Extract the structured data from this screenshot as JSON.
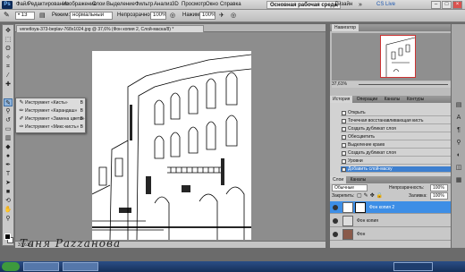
{
  "app": {
    "logo": "Ps",
    "menu": [
      "Файл",
      "Редактирование",
      "Изображение",
      "Слои",
      "Выделение",
      "Фильтр",
      "Анализ",
      "3D",
      "Просмотр",
      "Окно",
      "Справка"
    ],
    "zoom": "37,6",
    "workspace_label": "Основная рабочая среда",
    "design_label": "Дизайн",
    "cs_live": "CS Live"
  },
  "options": {
    "mode_label": "Режим:",
    "mode_value": "нормальный",
    "opacity_label": "Непрозрачность:",
    "opacity_value": "100%",
    "pressure_label": "Нажим:",
    "pressure_value": "100%"
  },
  "document": {
    "tab_title": "venetloya-373-beplav-768x1024.jpg @ 37,6% (Фон копия 2, Слой-маска/8) *",
    "status": "37,61%",
    "watermark": "Таня Раzzанова"
  },
  "flyout": {
    "items": [
      {
        "label": "Инструмент «Кисть»",
        "key": "B",
        "icon": "brush-icon"
      },
      {
        "label": "Инструмент «Карандаш»",
        "key": "B",
        "icon": "pencil-icon"
      },
      {
        "label": "Инструмент «Замена цвета»",
        "key": "B",
        "icon": "color-replace-icon"
      },
      {
        "label": "Инструмент «Микс-кисть»",
        "key": "B",
        "icon": "mixer-brush-icon"
      }
    ]
  },
  "navigator": {
    "title": "Навигатор",
    "zoom": "37,61%"
  },
  "history": {
    "tabs": [
      "История",
      "Операции",
      "Каналы",
      "Контуры"
    ],
    "items": [
      "Открыть",
      "Точечная восстанавливающая кисть",
      "Создать дубликат слоя",
      "Обесцветить",
      "Выделение краев",
      "Создать дубликат слоя",
      "Уровни",
      "Добавить слой-маску"
    ],
    "selected": 7
  },
  "layers": {
    "tabs": [
      "Слои",
      "Каналы"
    ],
    "blend_mode": "Обычные",
    "opacity_label": "Непрозрачность:",
    "opacity_value": "100%",
    "lock_label": "Закрепить:",
    "fill_label": "Заливка:",
    "fill_value": "100%",
    "items": [
      {
        "name": "Фон копия 2",
        "selected": true,
        "mask": true
      },
      {
        "name": "Фон копия",
        "selected": false,
        "mask": false
      },
      {
        "name": "Фон",
        "selected": false,
        "mask": false
      }
    ]
  }
}
